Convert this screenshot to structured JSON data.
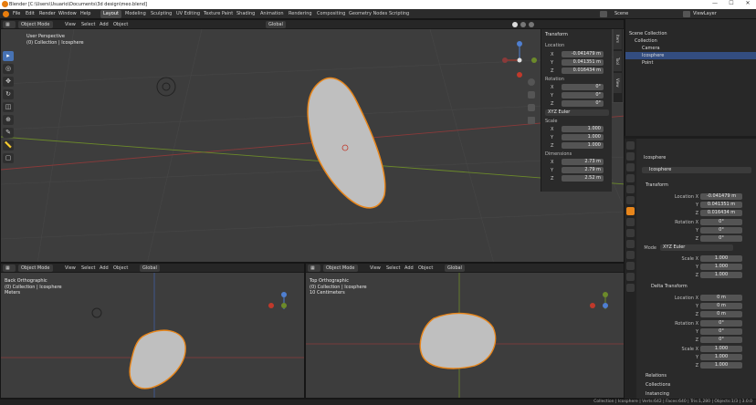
{
  "titlebar": {
    "title": "Blender [C:\\Users\\Usuario\\Documents\\3d design\\meo.blend]",
    "min": "—",
    "max": "☐",
    "close": "✕"
  },
  "menu": [
    "File",
    "Edit",
    "Render",
    "Window",
    "Help"
  ],
  "workspaces": [
    "Layout",
    "Modeling",
    "Sculpting",
    "UV Editing",
    "Texture Paint",
    "Shading",
    "Animation",
    "Rendering",
    "Compositing",
    "Geometry Nodes",
    "Scripting"
  ],
  "scene": {
    "scene_label": "Scene",
    "viewlayer_label": "ViewLayer"
  },
  "viewport_main": {
    "mode": "Object Mode",
    "menus": [
      "View",
      "Select",
      "Add",
      "Object"
    ],
    "orientation": "Global",
    "info_line1": "User Perspective",
    "info_line2": "(0) Collection | Icosphere"
  },
  "viewport_back": {
    "mode": "Object Mode",
    "menus": [
      "View",
      "Select",
      "Add",
      "Object"
    ],
    "orientation": "Global",
    "info_line1": "Back Orthographic",
    "info_line2": "(0) Collection | Icosphere",
    "info_line3": "Meters"
  },
  "viewport_top": {
    "mode": "Object Mode",
    "menus": [
      "View",
      "Select",
      "Add",
      "Object"
    ],
    "orientation": "Global",
    "info_line1": "Top Orthographic",
    "info_line2": "(0) Collection | Icosphere",
    "info_line3": "10 Centimeters"
  },
  "npanel": {
    "transform": "Transform",
    "location": "Location",
    "loc": [
      "-0.041479 m",
      "0.041351 m",
      "0.016434 m"
    ],
    "rotation": "Rotation",
    "rot": [
      "0°",
      "0°",
      "0°"
    ],
    "rotation_mode": "XYZ Euler",
    "scale": "Scale",
    "scl": [
      "1.000",
      "1.000",
      "1.000"
    ],
    "dimensions": "Dimensions",
    "dim": [
      "2.73 m",
      "2.79 m",
      "2.52 m"
    ],
    "axes": [
      "X",
      "Y",
      "Z"
    ],
    "tabs": [
      "Item",
      "Tool",
      "View"
    ]
  },
  "outliner": {
    "rows": [
      "Scene Collection",
      "Collection",
      "Camera",
      "Icosphere",
      "Point"
    ]
  },
  "props": {
    "object_name": "Icosphere",
    "object_field": "Icosphere",
    "transform": "Transform",
    "location_x": "Location X",
    "y": "Y",
    "z": "Z",
    "loc": [
      "-0.041479 m",
      "0.041351 m",
      "0.016434 m"
    ],
    "rotation_x": "Rotation X",
    "rot": [
      "0°",
      "0°",
      "0°"
    ],
    "mode_label": "Mode",
    "mode": "XYZ Euler",
    "scale_x": "Scale X",
    "scl": [
      "1.000",
      "1.000",
      "1.000"
    ],
    "delta": "Delta Transform",
    "dloc": [
      "0 m",
      "0 m",
      "0 m"
    ],
    "drot": [
      "0°",
      "0°",
      "0°"
    ],
    "dscl": [
      "1.000",
      "1.000",
      "1.000"
    ],
    "relations": "Relations",
    "collections": "Collections",
    "instancing": "Instancing"
  },
  "statusbar": {
    "right": "Collection | Icosphere | Verts:642 | Faces:640 | Tris:1,280 | Objects:1/3 | 3.0.0"
  },
  "colors": {
    "accent": "#4772b3",
    "selection": "#e8861b",
    "xaxis": "#9a3b3b",
    "yaxis": "#6c8a2a"
  }
}
